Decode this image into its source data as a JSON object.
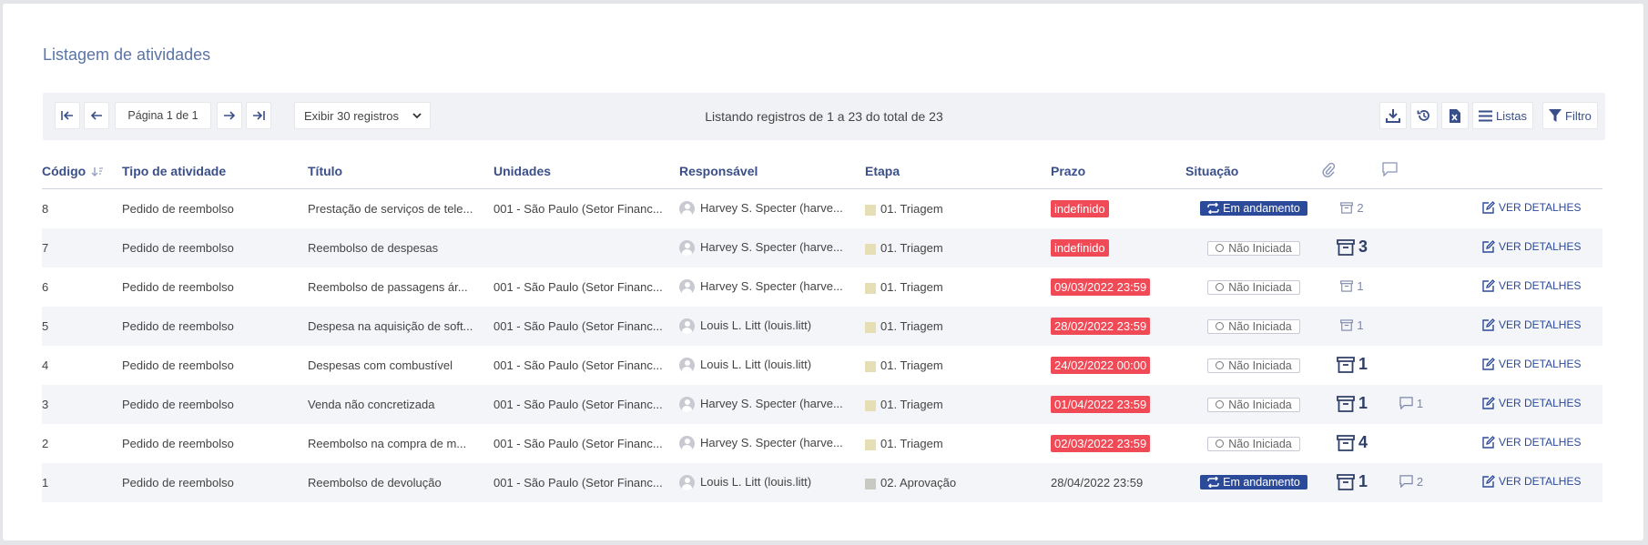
{
  "page": {
    "title": "Listagem de atividades"
  },
  "toolbar": {
    "page_label": "Página 1 de 1",
    "per_page": "Exibir 30 registros",
    "listing_info": "Listando registros de 1 a 23 do total de 23",
    "lists_label": "Listas",
    "filter_label": "Filtro"
  },
  "columns": {
    "code": "Código",
    "type": "Tipo de atividade",
    "title": "Título",
    "unit": "Unidades",
    "owner": "Responsável",
    "stage": "Etapa",
    "deadline": "Prazo",
    "status": "Situação"
  },
  "details_label": "VER DETALHES",
  "colors": {
    "accent": "#2c4a9a",
    "deadline_overdue": "#f04a56",
    "stage_triagem": "#e6dfb6",
    "stage_aprovacao": "#c9c9c4"
  },
  "rows": [
    {
      "code": "8",
      "type": "Pedido de reembolso",
      "title": "Prestação de serviços de tele...",
      "unit": "001 - São Paulo (Setor Financ...",
      "owner": "Harvey S. Specter (harve...",
      "stage": "01. Triagem",
      "deadline": "indefinido",
      "status": "Em andamento",
      "attachments": "2",
      "comments": ""
    },
    {
      "code": "7",
      "type": "Pedido de reembolso",
      "title": "Reembolso de despesas",
      "unit": "",
      "owner": "Harvey S. Specter (harve...",
      "stage": "01. Triagem",
      "deadline": "indefinido",
      "status": "Não Iniciada",
      "attachments": "3",
      "comments": ""
    },
    {
      "code": "6",
      "type": "Pedido de reembolso",
      "title": "Reembolso de passagens ár...",
      "unit": "001 - São Paulo (Setor Financ...",
      "owner": "Harvey S. Specter (harve...",
      "stage": "01. Triagem",
      "deadline": "09/03/2022 23:59",
      "status": "Não Iniciada",
      "attachments": "1",
      "comments": ""
    },
    {
      "code": "5",
      "type": "Pedido de reembolso",
      "title": "Despesa na aquisição de soft...",
      "unit": "001 - São Paulo (Setor Financ...",
      "owner": "Louis L. Litt (louis.litt)",
      "stage": "01. Triagem",
      "deadline": "28/02/2022 23:59",
      "status": "Não Iniciada",
      "attachments": "1",
      "comments": ""
    },
    {
      "code": "4",
      "type": "Pedido de reembolso",
      "title": "Despesas com combustível",
      "unit": "001 - São Paulo (Setor Financ...",
      "owner": "Louis L. Litt (louis.litt)",
      "stage": "01. Triagem",
      "deadline": "24/02/2022 00:00",
      "status": "Não Iniciada",
      "attachments": "1",
      "comments": ""
    },
    {
      "code": "3",
      "type": "Pedido de reembolso",
      "title": "Venda não concretizada",
      "unit": "001 - São Paulo (Setor Financ...",
      "owner": "Harvey S. Specter (harve...",
      "stage": "01. Triagem",
      "deadline": "01/04/2022 23:59",
      "status": "Não Iniciada",
      "attachments": "1",
      "comments": "1"
    },
    {
      "code": "2",
      "type": "Pedido de reembolso",
      "title": "Reembolso na compra de m...",
      "unit": "001 - São Paulo (Setor Financ...",
      "owner": "Harvey S. Specter (harve...",
      "stage": "01. Triagem",
      "deadline": "02/03/2022 23:59",
      "status": "Não Iniciada",
      "attachments": "4",
      "comments": ""
    },
    {
      "code": "1",
      "type": "Pedido de reembolso",
      "title": "Reembolso de devolução",
      "unit": "001 - São Paulo (Setor Financ...",
      "owner": "Louis L. Litt (louis.litt)",
      "stage": "02. Aprovação",
      "deadline": "28/04/2022 23:59",
      "status": "Em andamento",
      "attachments": "1",
      "comments": "2"
    }
  ]
}
